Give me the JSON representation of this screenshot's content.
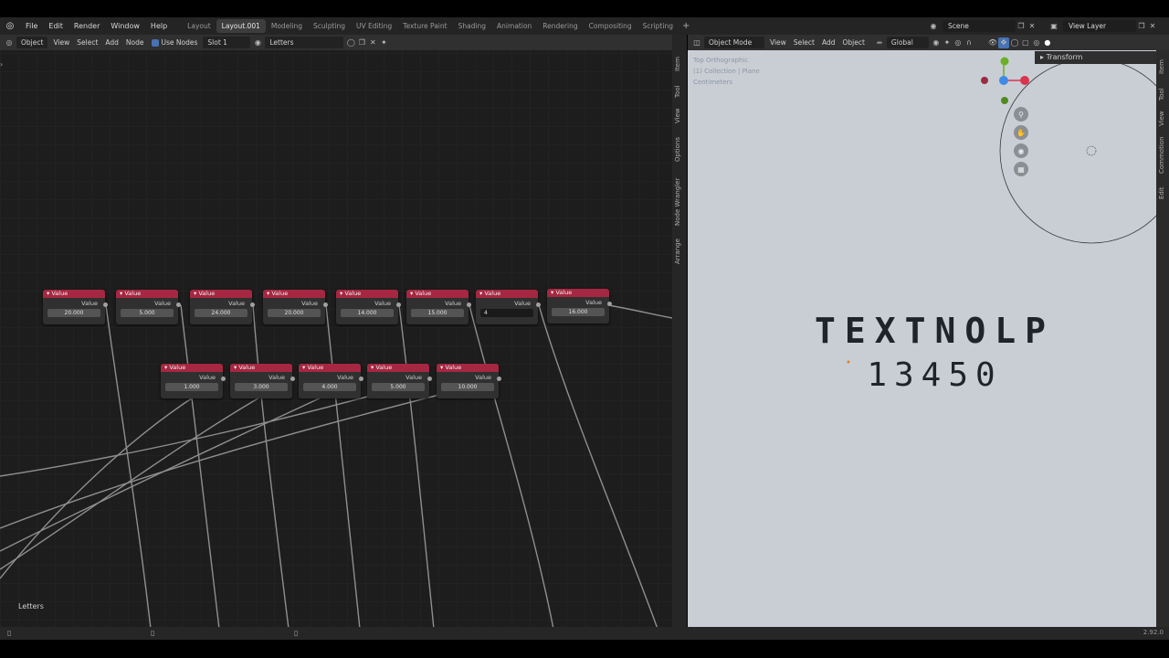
{
  "menu": {
    "items": [
      "File",
      "Edit",
      "Render",
      "Window",
      "Help"
    ],
    "workspaces": [
      "Layout",
      "Layout.001",
      "Modeling",
      "Sculpting",
      "UV Editing",
      "Texture Paint",
      "Shading",
      "Animation",
      "Rendering",
      "Compositing",
      "Scripting"
    ],
    "active_workspace": "Layout.001",
    "scene": "Scene",
    "view_layer": "View Layer"
  },
  "node_editor": {
    "header": {
      "type_select": "Object",
      "view": "View",
      "select": "Select",
      "add": "Add",
      "node": "Node",
      "use_nodes": "Use Nodes",
      "slot": "Slot 1",
      "material": "Letters"
    },
    "side_tabs": [
      "Item",
      "Tool",
      "View",
      "Options",
      "Node Wrangler",
      "Arrange"
    ],
    "tree_label": "Letters",
    "nodes_row1": [
      {
        "title": "Value",
        "output": "Value",
        "value": "20.000"
      },
      {
        "title": "Value",
        "output": "Value",
        "value": "5.000"
      },
      {
        "title": "Value",
        "output": "Value",
        "value": "24.000"
      },
      {
        "title": "Value",
        "output": "Value",
        "value": "20.000"
      },
      {
        "title": "Value",
        "output": "Value",
        "value": "14.000"
      },
      {
        "title": "Value",
        "output": "Value",
        "value": "15.000"
      },
      {
        "title": "Value",
        "output": "Value",
        "value": "4"
      },
      {
        "title": "Value",
        "output": "Value",
        "value": "16.000"
      }
    ],
    "nodes_row2": [
      {
        "title": "Value",
        "output": "Value",
        "value": "1.000"
      },
      {
        "title": "Value",
        "output": "Value",
        "value": "3.000"
      },
      {
        "title": "Value",
        "output": "Value",
        "value": "4.000"
      },
      {
        "title": "Value",
        "output": "Value",
        "value": "5.000"
      },
      {
        "title": "Value",
        "output": "Value",
        "value": "10.000"
      }
    ]
  },
  "viewport": {
    "header": {
      "mode": "Object Mode",
      "view": "View",
      "select": "Select",
      "add": "Add",
      "object": "Object",
      "orientation": "Global"
    },
    "info_lines": [
      "Top Orthographic",
      "(1) Collection | Plane",
      "Centimeters"
    ],
    "text_line1": "TEXTNOLP",
    "text_line2": "13450",
    "transform_panel": "Transform",
    "side_tabs": [
      "Item",
      "Tool",
      "View",
      "Commotion",
      "Edit"
    ],
    "gizmo": {
      "x_label": "X",
      "y_label": "Y",
      "z_label": "Z"
    }
  },
  "status": {
    "version": "2.92.0"
  },
  "colors": {
    "node_header": "#a62741",
    "viewport_bg": "#c9ced5",
    "accent": "#4772b3"
  }
}
